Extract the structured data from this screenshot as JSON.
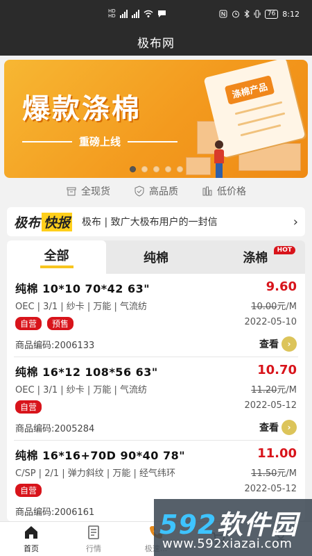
{
  "status_bar": {
    "time": "8:12",
    "battery": "76",
    "network": "4G"
  },
  "app": {
    "title": "极布网"
  },
  "banner": {
    "headline": "爆款涤棉",
    "subline": "重磅上线",
    "tag": "涤棉产品",
    "page_count": 5,
    "active_page": 1
  },
  "features": [
    {
      "label": "全现货",
      "icon": "box-icon"
    },
    {
      "label": "高品质",
      "icon": "shield-check-icon"
    },
    {
      "label": "低价格",
      "icon": "chart-bars-icon"
    }
  ],
  "news": {
    "logo_prefix": "极布",
    "logo_highlight": "快报",
    "text": "极布 | 致广大极布用户的一封信"
  },
  "tabs": [
    {
      "label": "全部",
      "active": true,
      "badge": ""
    },
    {
      "label": "纯棉",
      "active": false,
      "badge": ""
    },
    {
      "label": "涤棉",
      "active": false,
      "badge": "HOT"
    }
  ],
  "products": [
    {
      "spec": "纯棉   10*10   70*42   63\"",
      "attrs": "OEC | 3/1 | 纱卡 | 万能 | 气流纺",
      "tags": [
        "自营",
        "预售"
      ],
      "code": "商品编码:2006133",
      "price": "9.60",
      "old_price": "10.00",
      "unit": "元/M",
      "date": "2022-05-10",
      "view_label": "查看"
    },
    {
      "spec": "纯棉   16*12   108*56   63\"",
      "attrs": "OEC | 3/1 | 纱卡 | 万能 | 气流纺",
      "tags": [
        "自营"
      ],
      "code": "商品编码:2005284",
      "price": "10.70",
      "old_price": "11.20",
      "unit": "元/M",
      "date": "2022-05-12",
      "view_label": "查看"
    },
    {
      "spec": "纯棉   16*16+70D   90*40   78\"",
      "attrs": "C/SP | 2/1 | 弹力斜纹 | 万能 | 经气纬环",
      "tags": [
        "自营"
      ],
      "code": "商品编码:2006161",
      "price": "11.00",
      "old_price": "11.50",
      "unit": "元/M",
      "date": "2022-05-12",
      "view_label": "查看"
    }
  ],
  "bottom_nav": [
    {
      "label": "首页",
      "active": true
    },
    {
      "label": "行情",
      "active": false
    },
    {
      "label": "极速...",
      "active": false
    },
    {
      "label": "",
      "active": false
    },
    {
      "label": "",
      "active": false
    }
  ],
  "watermark": {
    "brand_num": "592",
    "brand_text": "软件园",
    "url": "www.592xiazai.com"
  },
  "colors": {
    "accent_red": "#d8141b",
    "accent_yellow": "#f7c51e",
    "banner_orange": "#f39a1e",
    "topbar": "#2b2b2b"
  }
}
